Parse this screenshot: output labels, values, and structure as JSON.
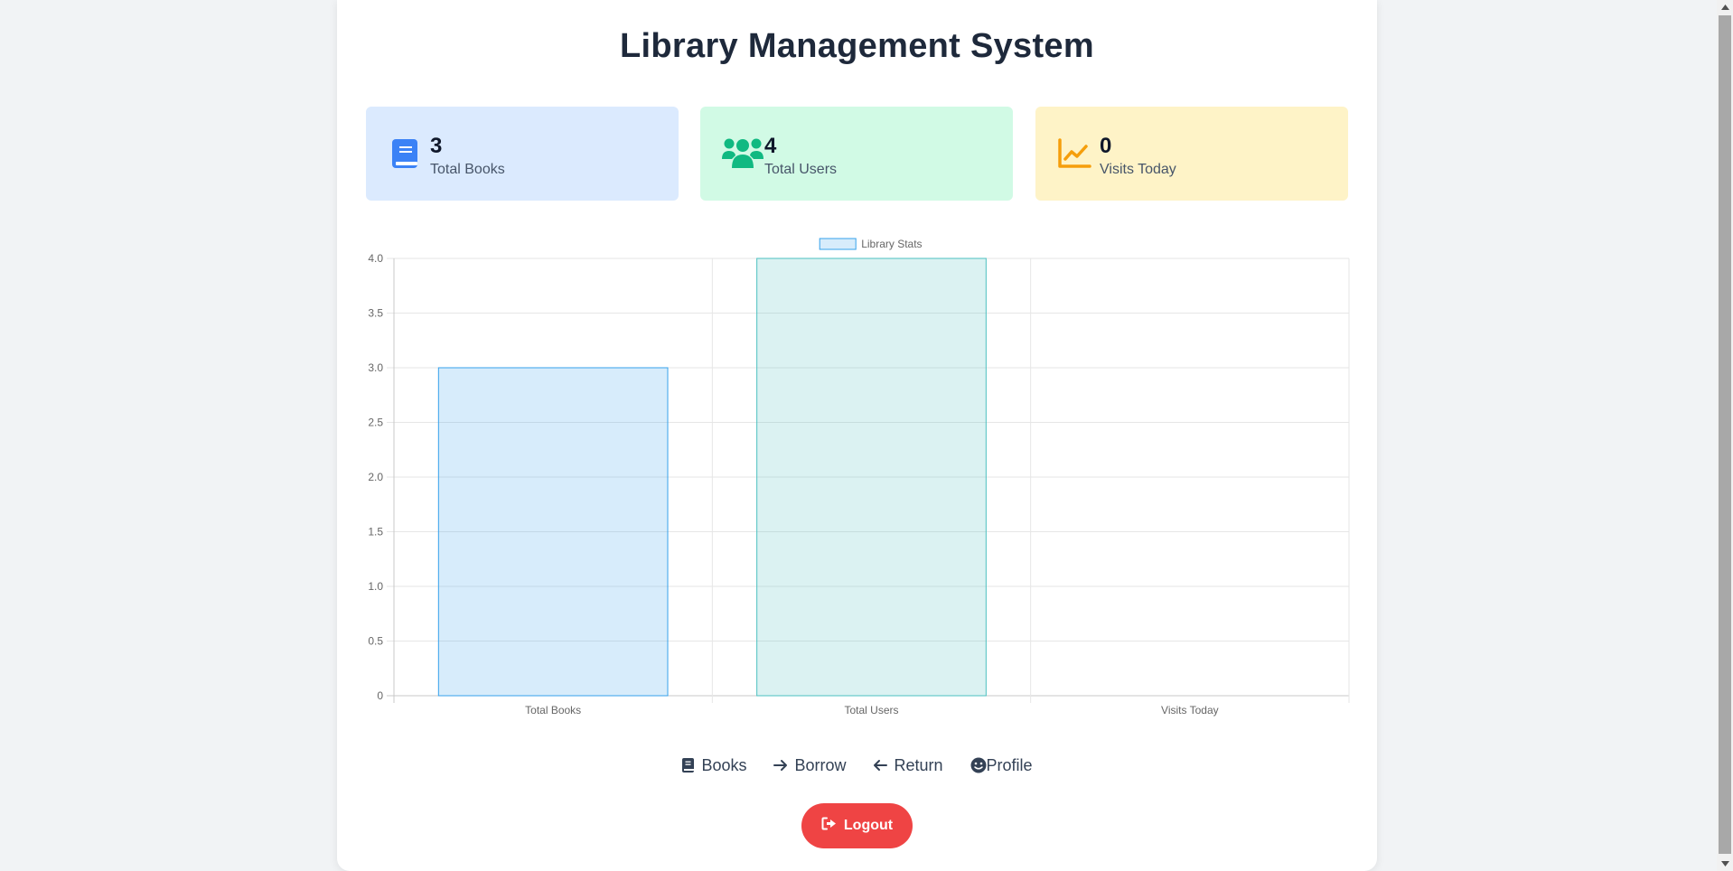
{
  "app": {
    "title": "Library Management System"
  },
  "stats": [
    {
      "value": "3",
      "label": "Total Books",
      "icon": "book-icon",
      "bg": "#dbeafe",
      "icon_color": "#3b82f6"
    },
    {
      "value": "4",
      "label": "Total Users",
      "icon": "users-icon",
      "bg": "#d1fae5",
      "icon_color": "#10b981"
    },
    {
      "value": "0",
      "label": "Visits Today",
      "icon": "chart-line-icon",
      "bg": "#fef3c7",
      "icon_color": "#f59e0b"
    }
  ],
  "chart_data": {
    "type": "bar",
    "categories": [
      "Total Books",
      "Total Users",
      "Visits Today"
    ],
    "series": [
      {
        "name": "Library Stats",
        "values": [
          3,
          4,
          0
        ]
      }
    ],
    "ylim": [
      0,
      4
    ],
    "yticks": [
      "0",
      "0.5",
      "1.0",
      "1.5",
      "2.0",
      "2.5",
      "3.0",
      "3.5",
      "4.0"
    ],
    "bar_fills": [
      "rgba(54,162,235,0.2)",
      "rgba(75,192,192,0.2)",
      "rgba(255,206,86,0.2)"
    ],
    "bar_strokes": [
      "#36a2eb",
      "#4bc0c0",
      "#ffce56"
    ],
    "legend_fill": "rgba(54,162,235,0.2)",
    "legend_stroke": "#36a2eb",
    "legend_position": "top",
    "grid": true
  },
  "nav": [
    {
      "label": "Books",
      "icon": "book-icon"
    },
    {
      "label": "Borrow",
      "icon": "arrow-right-icon"
    },
    {
      "label": "Return",
      "icon": "arrow-left-icon"
    },
    {
      "label": "Profile",
      "icon": "smile-icon"
    }
  ],
  "logout": {
    "label": "Logout",
    "icon": "sign-out-icon",
    "color": "#ef4444"
  }
}
